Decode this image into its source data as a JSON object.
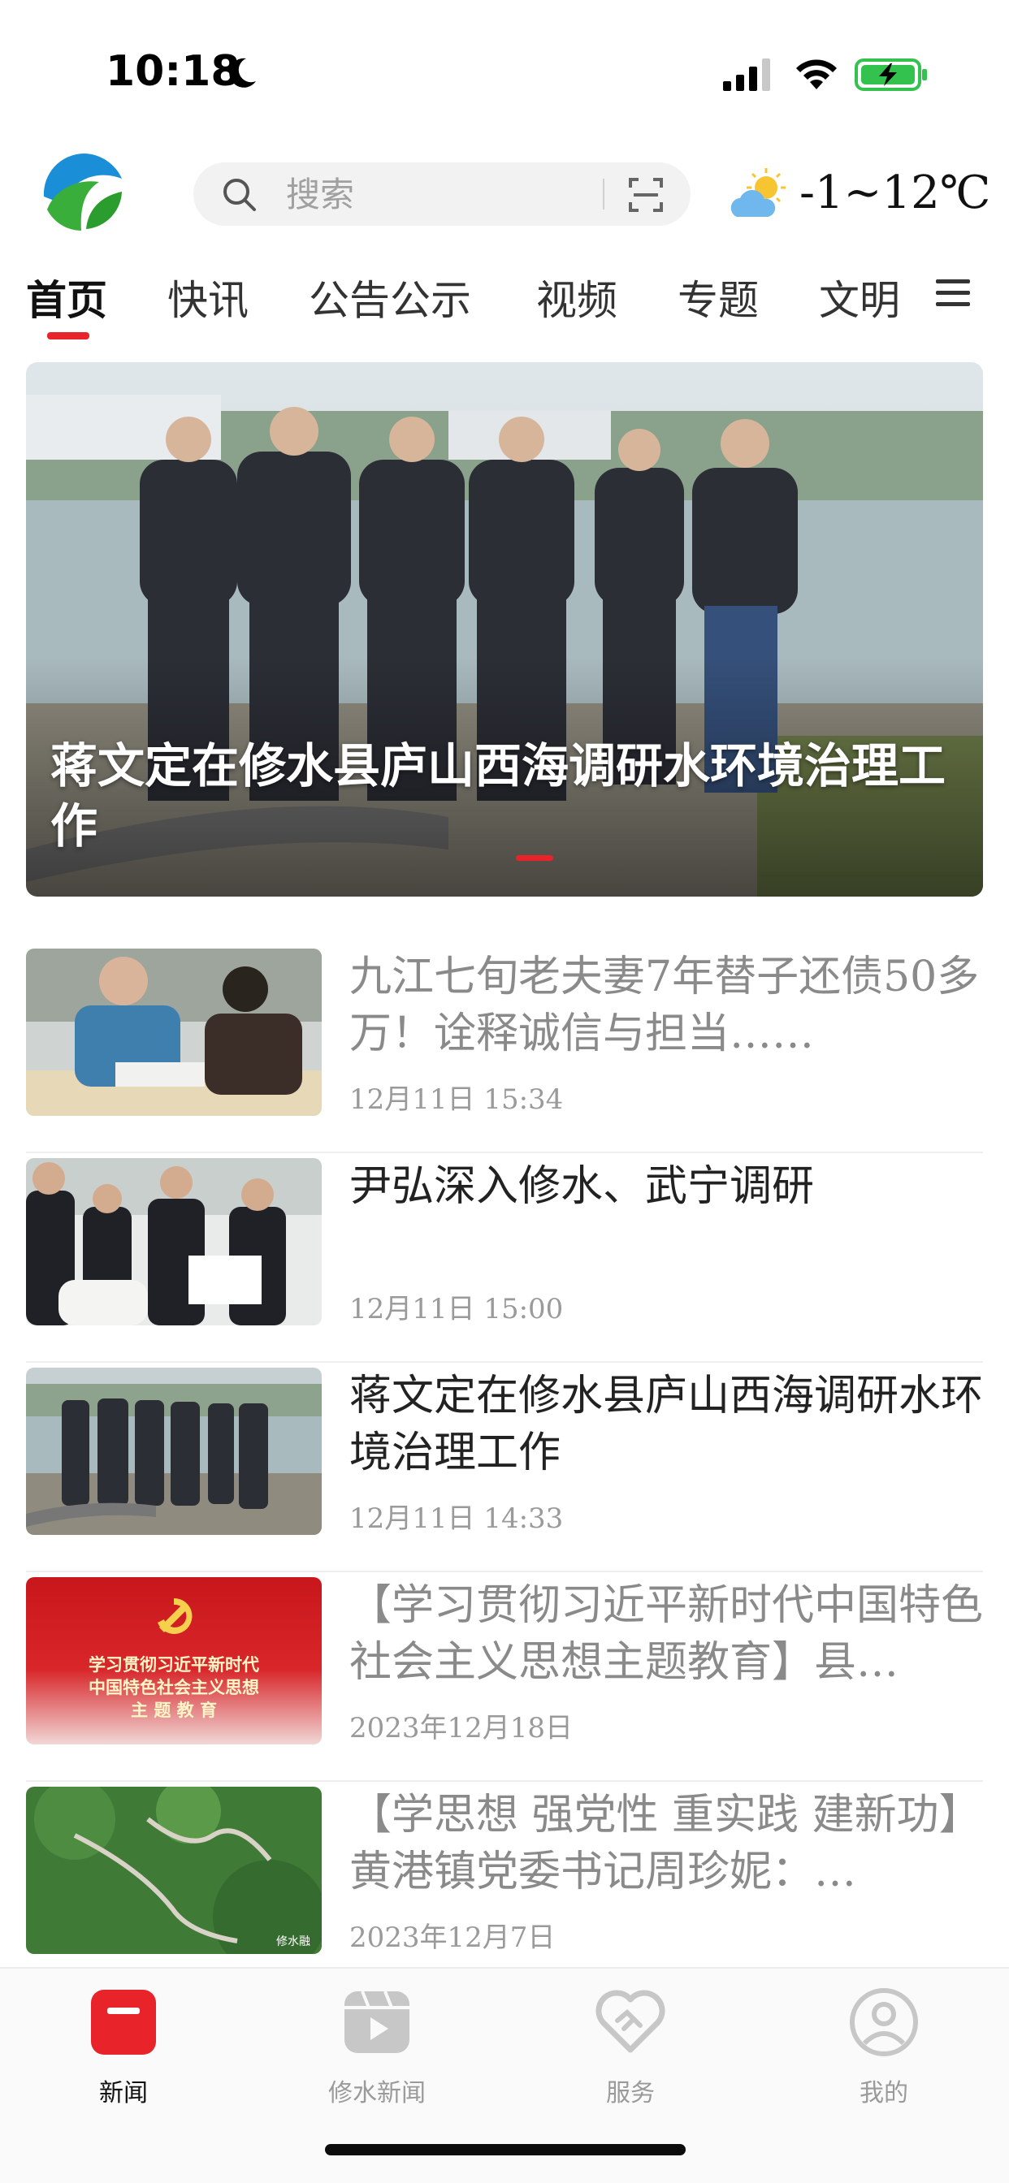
{
  "status_bar": {
    "time": "10:18"
  },
  "header": {
    "search_placeholder": "搜索",
    "weather_temp": "-1~12℃"
  },
  "tabs": [
    {
      "label": "首页",
      "active": true
    },
    {
      "label": "快讯"
    },
    {
      "label": "公告公示"
    },
    {
      "label": "视频"
    },
    {
      "label": "专题"
    },
    {
      "label": "文明"
    }
  ],
  "hero": {
    "title": "蒋文定在修水县庐山西海调研水环境治理工作"
  },
  "news": [
    {
      "title": "九江七旬老夫妻7年替子还债50多万！诠释诚信与担当……",
      "date": "12月11日 15:34",
      "read": true
    },
    {
      "title": "尹弘深入修水、武宁调研",
      "date": "12月11日 15:00",
      "read": false
    },
    {
      "title": "蒋文定在修水县庐山西海调研水环境治理工作",
      "date": "12月11日 14:33",
      "read": false
    },
    {
      "title": "【学习贯彻习近平新时代中国特色社会主义思想主题教育】县…",
      "date": "2023年12月18日",
      "read": true,
      "thumb_text": [
        "学习贯彻习近平新时代",
        "中国特色社会主义思想",
        "主 题 教 育"
      ]
    },
    {
      "title": "【学思想 强党性 重实践 建新功】黄港镇党委书记周珍妮：…",
      "date": "2023年12月7日",
      "read": true,
      "thumb_watermark": "修水融"
    }
  ],
  "bottom_nav": [
    {
      "label": "新闻",
      "active": true
    },
    {
      "label": "修水新闻"
    },
    {
      "label": "服务"
    },
    {
      "label": "我的"
    }
  ],
  "colors": {
    "accent": "#e8232a",
    "read_text": "#8a8a8a",
    "date_text": "#9a9a9a"
  }
}
